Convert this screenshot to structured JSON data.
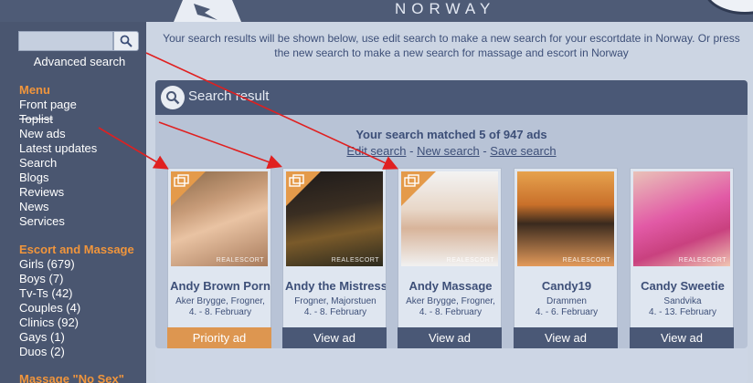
{
  "header": {
    "brand": "NORWAY"
  },
  "sidebar": {
    "search_placeholder": "",
    "advanced_search": "Advanced search",
    "menu_heading": "Menu",
    "menu_items": [
      "Front page",
      "Toplist",
      "New ads",
      "Latest updates",
      "Search",
      "Blogs",
      "Reviews",
      "News",
      "Services"
    ],
    "escort_heading": "Escort and Massage",
    "escort_items": [
      "Girls (679)",
      "Boys (7)",
      "Tv-Ts (42)",
      "Couples (4)",
      "Clinics (92)",
      "Gays (1)",
      "Duos (2)"
    ],
    "nosex_heading": "Massage \"No Sex\""
  },
  "main": {
    "info_text": "Your search results will be shown below, use edit search to make a new search for your escortdate in Norway. Or press the new search to make a new search for massage and escort in Norway",
    "panel_title": "Search result",
    "matched": "Your search matched 5 of 947 ads",
    "links": {
      "edit": "Edit search",
      "new": "New search",
      "save": "Save search",
      "sep": "-"
    },
    "watermark": "REALESCORT",
    "cards": [
      {
        "name": "Andy Brown Porn",
        "location": "Aker Brygge, Frogner,",
        "dates": "4. - 8. February",
        "button": "Priority ad",
        "priority": true,
        "ribbon": true
      },
      {
        "name": "Andy the Mistress",
        "location": "Frogner, Majorstuen",
        "dates": "4. - 8. February",
        "button": "View ad",
        "priority": false,
        "ribbon": true
      },
      {
        "name": "Andy Massage",
        "location": "Aker Brygge, Frogner,",
        "dates": "4. - 8. February",
        "button": "View ad",
        "priority": false,
        "ribbon": true
      },
      {
        "name": "Candy19",
        "location": "Drammen",
        "dates": "4. - 6. February",
        "button": "View ad",
        "priority": false,
        "ribbon": false
      },
      {
        "name": "Candy Sweetie",
        "location": "Sandvika",
        "dates": "4. - 13. February",
        "button": "View ad",
        "priority": false,
        "ribbon": false
      }
    ]
  },
  "colors": {
    "accent": "#f0953c",
    "header_bg": "#4a5876",
    "text_dark": "#3d4f78",
    "arrow": "#e02020"
  }
}
